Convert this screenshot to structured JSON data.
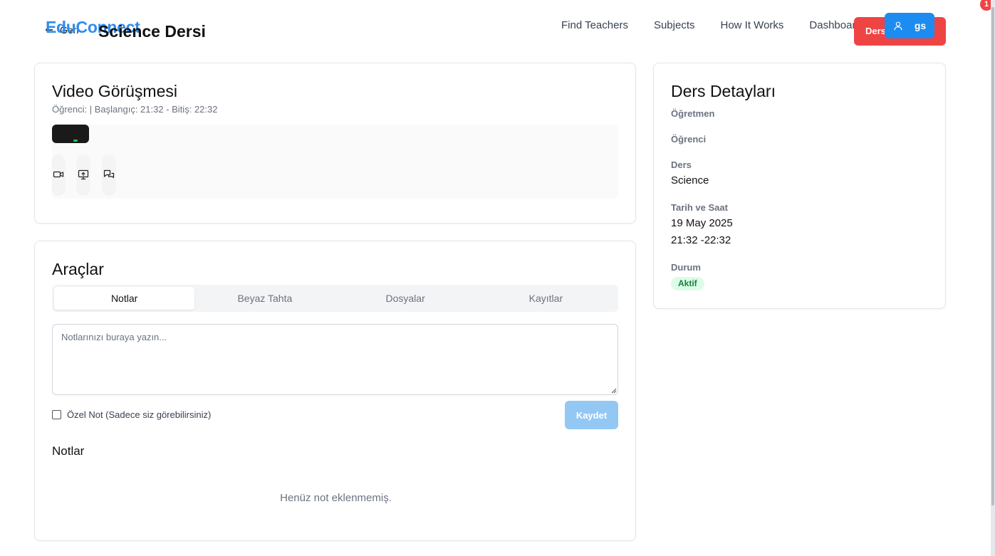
{
  "header": {
    "back_label": "Geri",
    "brand": "EduConnect",
    "page_title": "Science Dersi",
    "nav": [
      "Find Teachers",
      "Subjects",
      "How It Works",
      "Dashboard"
    ],
    "end_button_label": "Ders",
    "user_initials": "gs",
    "notification_count": "1"
  },
  "video": {
    "title": "Video Görüşmesi",
    "subtitle": "Öğrenci: | Başlangıç: 21:32 - Bitiş: 22:32",
    "controls": [
      {
        "icon": "video-camera-icon"
      },
      {
        "icon": "screen-share-icon"
      },
      {
        "icon": "chat-icon"
      }
    ]
  },
  "tools": {
    "title": "Araçlar",
    "tabs": [
      "Notlar",
      "Beyaz Tahta",
      "Dosyalar",
      "Kayıtlar"
    ],
    "active_tab": "Notlar",
    "notes_placeholder": "Notlarınızı buraya yazın...",
    "private_note_label": "Özel Not (Sadece siz görebilirsiniz)",
    "private_note_checked": false,
    "save_label": "Kaydet",
    "notes_heading": "Notlar",
    "empty_notes": "Henüz not eklenmemiş."
  },
  "details": {
    "title": "Ders Detayları",
    "teacher_label": "Öğretmen",
    "student_label": "Öğrenci",
    "subject_label": "Ders",
    "subject_value": "Science",
    "datetime_label": "Tarih ve Saat",
    "date_value": "19 May 2025",
    "time_value": "21:32 -22:32",
    "status_label": "Durum",
    "status_value": "Aktif"
  },
  "colors": {
    "brand": "#2f8cf0",
    "danger": "#ef4444",
    "primary": "#1d8cf0",
    "save_disabled": "#93c8f5",
    "status_bg": "#dcfce7",
    "status_text": "#15803d"
  }
}
